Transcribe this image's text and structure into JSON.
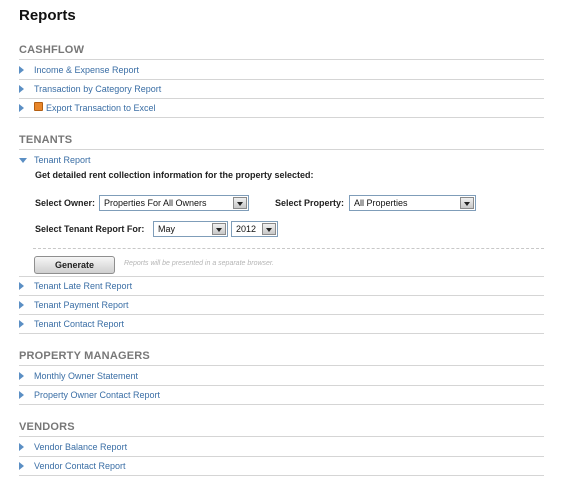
{
  "page": {
    "title": "Reports"
  },
  "cashflow": {
    "header": "CASHFLOW",
    "items": [
      {
        "label": "Income & Expense Report"
      },
      {
        "label": "Transaction by Category Report"
      },
      {
        "label": "Export Transaction to Excel",
        "icon": "excel-icon"
      }
    ]
  },
  "tenants": {
    "header": "TENANTS",
    "expanded": {
      "label": "Tenant Report",
      "description": "Get detailed rent collection information for the property selected:",
      "owner_label": "Select Owner:",
      "owner_value": "Properties For All Owners",
      "property_label": "Select Property:",
      "property_value": "All Properties",
      "report_for_label": "Select Tenant Report For:",
      "month_value": "May",
      "year_value": "2012",
      "generate_label": "Generate",
      "note": "Reports will be presented in a separate browser."
    },
    "items": [
      {
        "label": "Tenant Late Rent Report"
      },
      {
        "label": "Tenant Payment Report"
      },
      {
        "label": "Tenant Contact Report"
      }
    ]
  },
  "property_managers": {
    "header": "PROPERTY MANAGERS",
    "items": [
      {
        "label": "Monthly Owner Statement"
      },
      {
        "label": "Property Owner Contact Report"
      }
    ]
  },
  "vendors": {
    "header": "VENDORS",
    "items": [
      {
        "label": "Vendor Balance Report"
      },
      {
        "label": "Vendor Contact Report"
      }
    ]
  },
  "colors": {
    "link": "#3a6ea5",
    "header": "#777777",
    "triangle": "#5b8fc4",
    "excel_icon": "#e8862a"
  }
}
